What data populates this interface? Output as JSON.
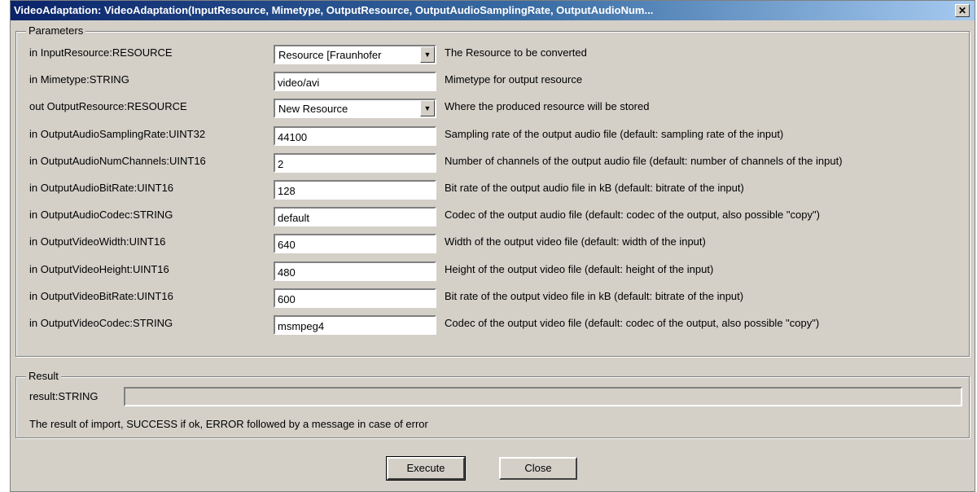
{
  "window": {
    "title": "VideoAdaptation: VideoAdaptation(InputResource, Mimetype, OutputResource, OutputAudioSamplingRate, OutputAudioNum...",
    "close_glyph": "✕"
  },
  "parameters": {
    "legend": "Parameters",
    "rows": [
      {
        "label": "in InputResource:RESOURCE",
        "kind": "select",
        "value": "Resource [Fraunhofer",
        "description": "The Resource to be converted"
      },
      {
        "label": "in Mimetype:STRING",
        "kind": "input",
        "value": "video/avi",
        "description": "Mimetype for output resource"
      },
      {
        "label": "out OutputResource:RESOURCE",
        "kind": "select",
        "value": "New Resource",
        "description": "Where the produced resource will be stored"
      },
      {
        "label": "in OutputAudioSamplingRate:UINT32",
        "kind": "input",
        "value": "44100",
        "description": "Sampling rate of the output audio file (default: sampling rate of the input)"
      },
      {
        "label": "in OutputAudioNumChannels:UINT16",
        "kind": "input",
        "value": "2",
        "description": "Number of channels of the output audio file (default: number of channels of the input)"
      },
      {
        "label": "in OutputAudioBitRate:UINT16",
        "kind": "input",
        "value": "128",
        "description": "Bit rate of the output audio file in kB (default: bitrate of the input)"
      },
      {
        "label": "in OutputAudioCodec:STRING",
        "kind": "input",
        "value": "default",
        "description": "Codec of the output audio file (default: codec of the output, also possible \"copy\")"
      },
      {
        "label": "in OutputVideoWidth:UINT16",
        "kind": "input",
        "value": "640",
        "description": "Width of the output video file (default: width of the input)"
      },
      {
        "label": "in OutputVideoHeight:UINT16",
        "kind": "input",
        "value": "480",
        "description": "Height of the output video file (default: height of the input)"
      },
      {
        "label": "in OutputVideoBitRate:UINT16",
        "kind": "input",
        "value": "600",
        "description": "Bit rate of the output video file in kB (default: bitrate of the input)"
      },
      {
        "label": "in OutputVideoCodec:STRING",
        "kind": "input",
        "value": "msmpeg4",
        "description": "Codec of the output video file (default: codec of the output, also possible \"copy\")"
      }
    ]
  },
  "result": {
    "legend": "Result",
    "label": "result:STRING",
    "value": "",
    "note": "The result of import, SUCCESS if ok, ERROR followed by a message in case of error"
  },
  "buttons": {
    "execute": "Execute",
    "close": "Close"
  }
}
